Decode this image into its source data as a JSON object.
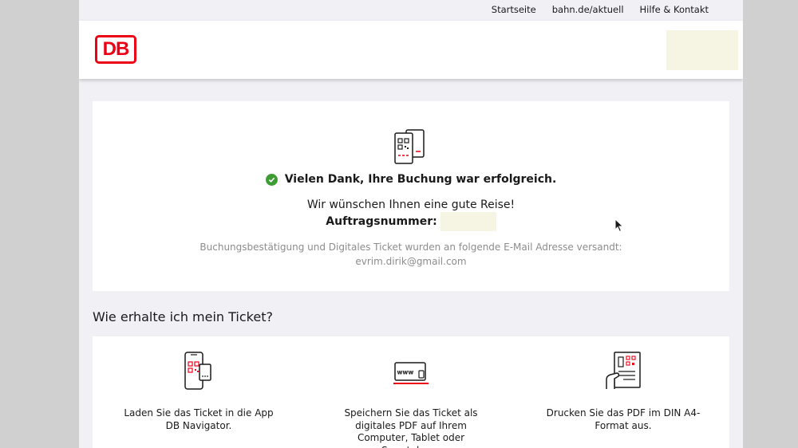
{
  "topnav": {
    "items": [
      "Startseite",
      "bahn.de/aktuell",
      "Hilfe & Kontakt"
    ]
  },
  "header": {
    "logo_text": "DB"
  },
  "confirmation": {
    "success_message": "Vielen Dank, Ihre Buchung war erfolgreich.",
    "wish": "Wir wünschen Ihnen eine gute Reise!",
    "order_label": "Auftragsnummer:",
    "email_notice": "Buchungsbestätigung und Digitales Ticket wurden an folgende E-Mail Adresse versandt:",
    "email": "evrim.dirik@gmail.com"
  },
  "ticket_section": {
    "title": "Wie erhalte ich mein Ticket?",
    "options": [
      {
        "icon": "phone-app-icon",
        "text": "Laden Sie das Ticket in die App DB Navigator."
      },
      {
        "icon": "www-pdf-icon",
        "text": "Speichern Sie das Ticket als digitales PDF auf Ihrem Computer, Tablet oder Smartphone"
      },
      {
        "icon": "print-document-icon",
        "text": "Drucken Sie das PDF im DIN A4-Format aus."
      }
    ]
  },
  "colors": {
    "brand_red": "#ec0016",
    "success_green": "#3f9c35",
    "page_bg": "#f0f0f5",
    "placeholder_box": "#f6f5e3"
  }
}
